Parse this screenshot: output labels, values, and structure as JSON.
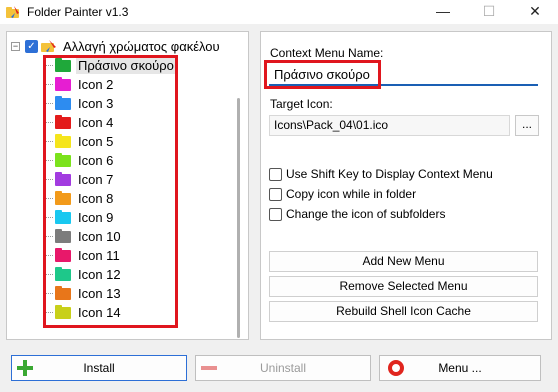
{
  "window": {
    "title": "Folder Painter v1.3",
    "min_glyph": "—",
    "max_glyph": "☐",
    "close_glyph": "✕"
  },
  "tree": {
    "root_label": "Αλλαγή χρώματος φακέλου",
    "expander_glyph": "−",
    "check_glyph": "✓",
    "items": [
      {
        "label": "Πράσινο σκούρο",
        "color": "#1fa83a",
        "selected": true
      },
      {
        "label": "Icon 2",
        "color": "#e61ed2"
      },
      {
        "label": "Icon 3",
        "color": "#2d8cf0"
      },
      {
        "label": "Icon 4",
        "color": "#e31b1b"
      },
      {
        "label": "Icon 5",
        "color": "#f5e51c"
      },
      {
        "label": "Icon 6",
        "color": "#7be21c"
      },
      {
        "label": "Icon 7",
        "color": "#a23be0"
      },
      {
        "label": "Icon 8",
        "color": "#f29a1a"
      },
      {
        "label": "Icon 9",
        "color": "#19c8f0"
      },
      {
        "label": "Icon 10",
        "color": "#7c7c7c"
      },
      {
        "label": "Icon 11",
        "color": "#e8186a"
      },
      {
        "label": "Icon 12",
        "color": "#1ec88a"
      },
      {
        "label": "Icon 13",
        "color": "#e8761a"
      },
      {
        "label": "Icon 14",
        "color": "#c8d01a"
      }
    ]
  },
  "editor": {
    "name_label": "Context Menu Name:",
    "name_value": "Πράσινο σκούρο",
    "target_label": "Target Icon:",
    "target_value": "Icons\\Pack_04\\01.ico",
    "browse_label": "...",
    "options": [
      {
        "label": "Use Shift Key to Display Context Menu",
        "checked": false
      },
      {
        "label": "Copy icon while in folder",
        "checked": false
      },
      {
        "label": "Change the icon of subfolders",
        "checked": false
      }
    ],
    "add_label": "Add New Menu",
    "remove_label": "Remove Selected Menu",
    "rebuild_label": "Rebuild Shell Icon Cache"
  },
  "bottom": {
    "install_label": "Install",
    "uninstall_label": "Uninstall",
    "menu_label": "Menu ..."
  },
  "colors": {
    "accent": "#2d6fd6",
    "highlight_box": "#e0161e"
  }
}
